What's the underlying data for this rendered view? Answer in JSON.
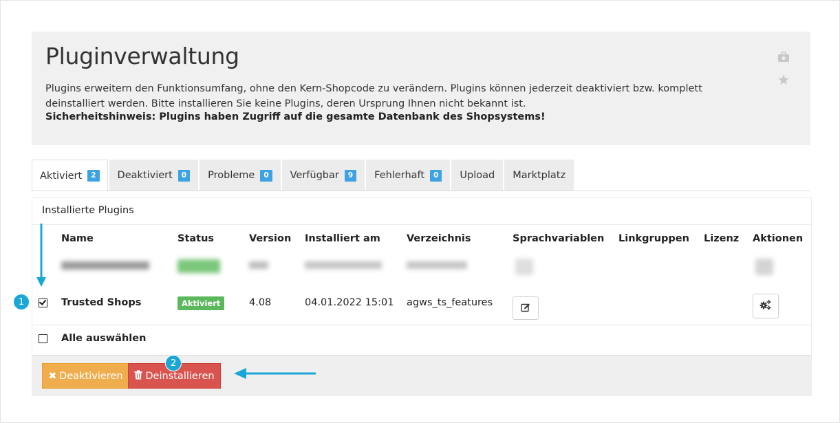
{
  "header": {
    "title": "Pluginverwaltung",
    "description": "Plugins erweitern den Funktionsumfang, ohne den Kern-Shopcode zu verändern. Plugins können jederzeit deaktiviert bzw. komplett deinstalliert werden. Bitte installieren Sie keine Plugins, deren Ursprung Ihnen nicht bekannt ist.",
    "warning": "Sicherheitshinweis: Plugins haben Zugriff auf die gesamte Datenbank des Shopsystems!",
    "icons": [
      "briefcase-icon",
      "star-icon"
    ]
  },
  "tabs": [
    {
      "label": "Aktiviert",
      "count": "2",
      "active": true
    },
    {
      "label": "Deaktiviert",
      "count": "0"
    },
    {
      "label": "Probleme",
      "count": "0"
    },
    {
      "label": "Verfügbar",
      "count": "9"
    },
    {
      "label": "Fehlerhaft",
      "count": "0"
    },
    {
      "label": "Upload",
      "count": ""
    },
    {
      "label": "Marktplatz",
      "count": ""
    }
  ],
  "panel": {
    "title": "Installierte Plugins",
    "columns": [
      "Name",
      "Status",
      "Version",
      "Installiert am",
      "Verzeichnis",
      "Sprachvariablen",
      "Linkgruppen",
      "Lizenz",
      "Aktionen"
    ],
    "rows": [
      {
        "name": "Trusted Shops",
        "status": "Aktiviert",
        "version": "4.08",
        "installed": "04.01.2022 15:01",
        "directory": "agws_ts_features",
        "checked": true
      }
    ],
    "select_all_label": "Alle auswählen"
  },
  "actions": {
    "deactivate_label": "Deaktivieren",
    "uninstall_label": "Deinstallieren"
  },
  "annotations": [
    "1",
    "2"
  ],
  "colors": {
    "accent": "#1aa7d6",
    "badge": "#3ea3e3",
    "active_status": "#5cb85c",
    "deactivate": "#f0ad4e",
    "uninstall": "#d9534f"
  }
}
